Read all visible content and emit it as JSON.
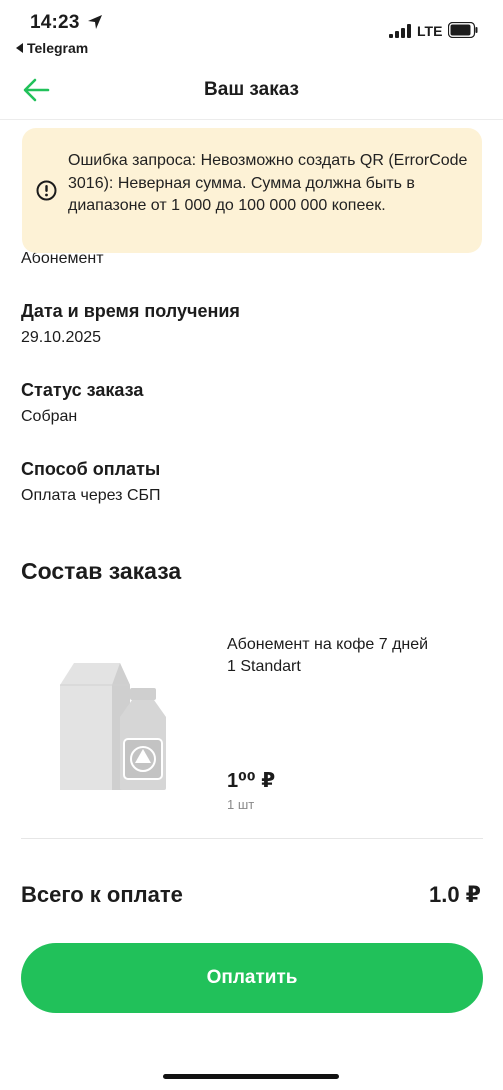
{
  "status_bar": {
    "time": "14:23",
    "back_app": "Telegram",
    "network": "LTE"
  },
  "header": {
    "title": "Ваш заказ"
  },
  "toast": {
    "message": "Ошибка запроса: Невозможно создать QR (ErrorCode 3016): Неверная сумма. Сумма должна быть в диапазоне от 1 000 до 100 000 000 копеек.",
    "icon": "exclamation-circle-icon"
  },
  "order": {
    "type_value": "Абонемент",
    "date_label": "Дата и время получения",
    "date_value": "29.10.2025",
    "status_label": "Статус заказа",
    "status_value": "Собран",
    "payment_label": "Способ оплаты",
    "payment_value": "Оплата через СБП"
  },
  "composition": {
    "title": "Состав заказа",
    "items": [
      {
        "name": "Абонемент на кофе 7 дней",
        "variant": "1 Standart",
        "price": "1⁰⁰ ₽",
        "quantity": "1 шт"
      }
    ]
  },
  "total": {
    "label": "Всего к оплате",
    "value": "1.0 ₽"
  },
  "pay_button": {
    "label": "Оплатить"
  },
  "colors": {
    "accent": "#21c15a",
    "toast_bg": "#fdf2d6"
  }
}
